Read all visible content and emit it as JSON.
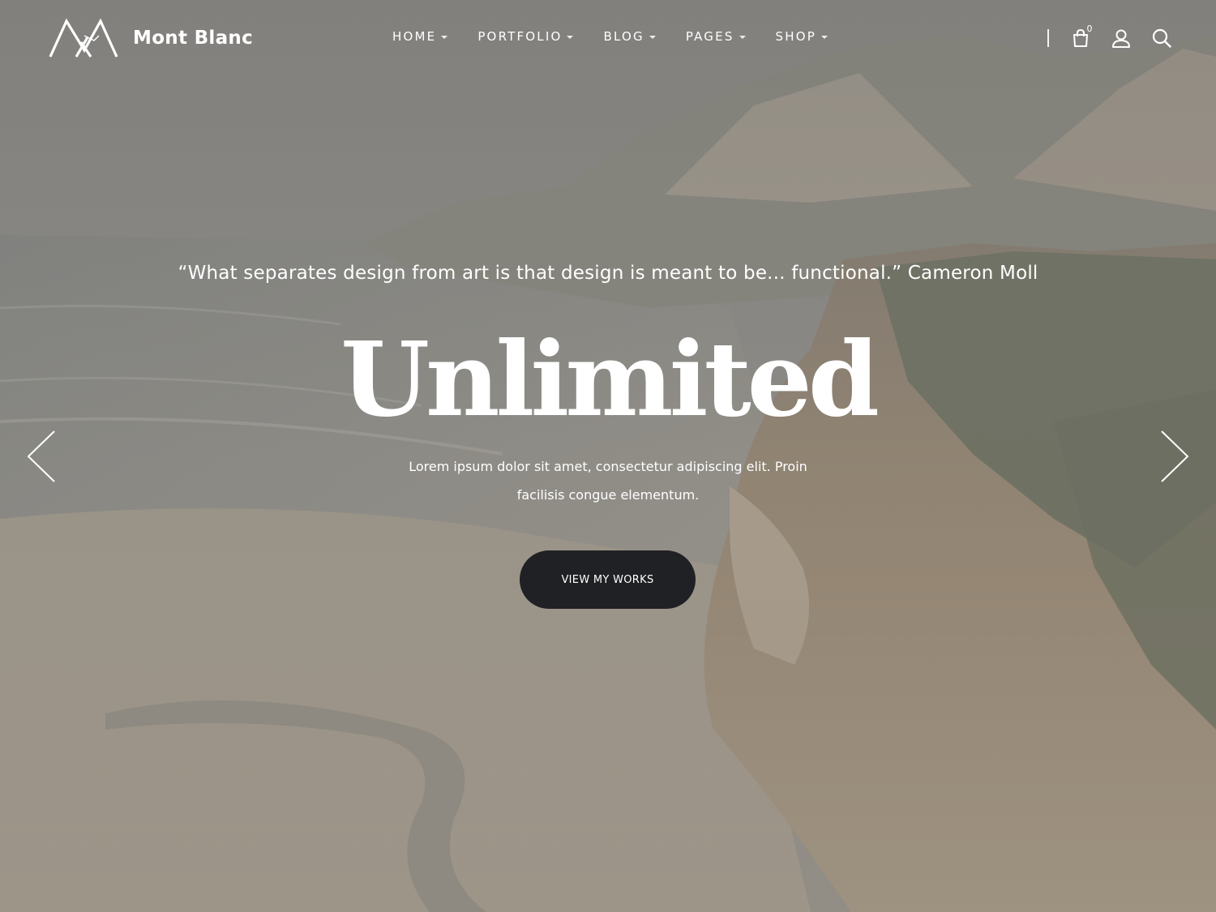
{
  "brand": {
    "name": "Mont Blanc",
    "logo_icon": "mountain-logo-icon"
  },
  "nav": {
    "items": [
      {
        "label": "HOME",
        "has_dropdown": true
      },
      {
        "label": "PORTFOLIO",
        "has_dropdown": true
      },
      {
        "label": "BLOG",
        "has_dropdown": true
      },
      {
        "label": "PAGES",
        "has_dropdown": true
      },
      {
        "label": "SHOP",
        "has_dropdown": true
      }
    ]
  },
  "tools": {
    "cart_icon": "shopping-bag-icon",
    "cart_count": "0",
    "account_icon": "user-icon",
    "search_icon": "search-icon"
  },
  "slide": {
    "quote": "“What separates design from art is that design is meant to be... functional.” Cameron Moll",
    "headline": "Unlimited",
    "subtext": "Lorem ipsum dolor sit amet, consectetur adipiscing elit. Proin facilisis congue elementum.",
    "cta_label": "VIEW MY WORKS",
    "prev_icon": "chevron-left-icon",
    "next_icon": "chevron-right-icon"
  },
  "colors": {
    "button_bg": "#202124",
    "text": "#ffffff",
    "overlay": "#8d8a83"
  }
}
